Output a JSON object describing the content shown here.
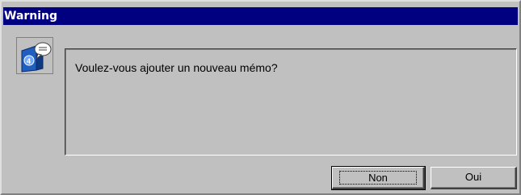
{
  "window": {
    "title": "Warning"
  },
  "icon": {
    "name": "memo-4d-icon"
  },
  "message": {
    "text": "Voulez-vous ajouter un nouveau mémo?"
  },
  "buttons": {
    "no_label": "Non",
    "yes_label": "Oui"
  },
  "colors": {
    "titlebar": "#000080",
    "face": "#c0c0c0"
  }
}
